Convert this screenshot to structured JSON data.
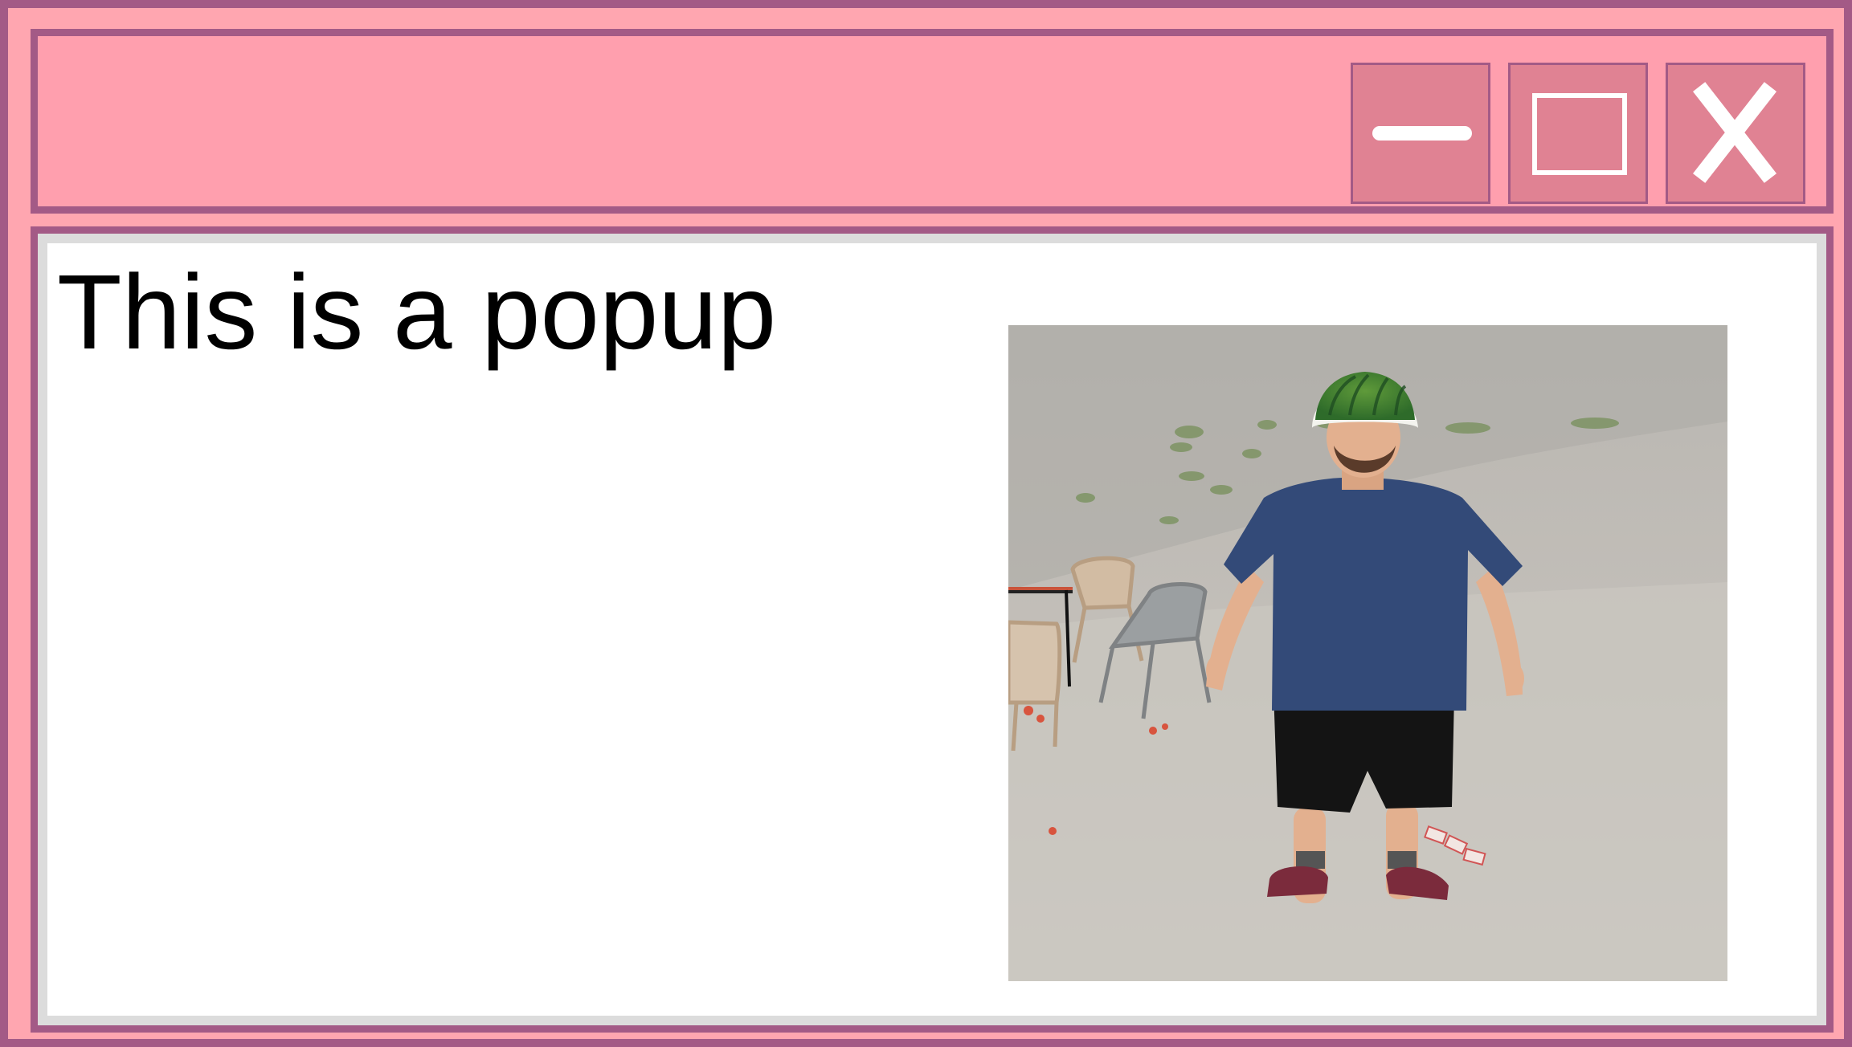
{
  "window": {
    "colors": {
      "frame": "#ffa6b0",
      "titlebar": "#ff9fae",
      "border": "#a35a86",
      "button": "#e08293",
      "content_background": "#ffffff"
    },
    "controls": {
      "minimize_icon": "minimize-icon",
      "maximize_icon": "maximize-icon",
      "close_icon": "close-icon"
    }
  },
  "content": {
    "text": "This is a popup",
    "image": {
      "description_icon": "photo",
      "alt": ""
    }
  }
}
